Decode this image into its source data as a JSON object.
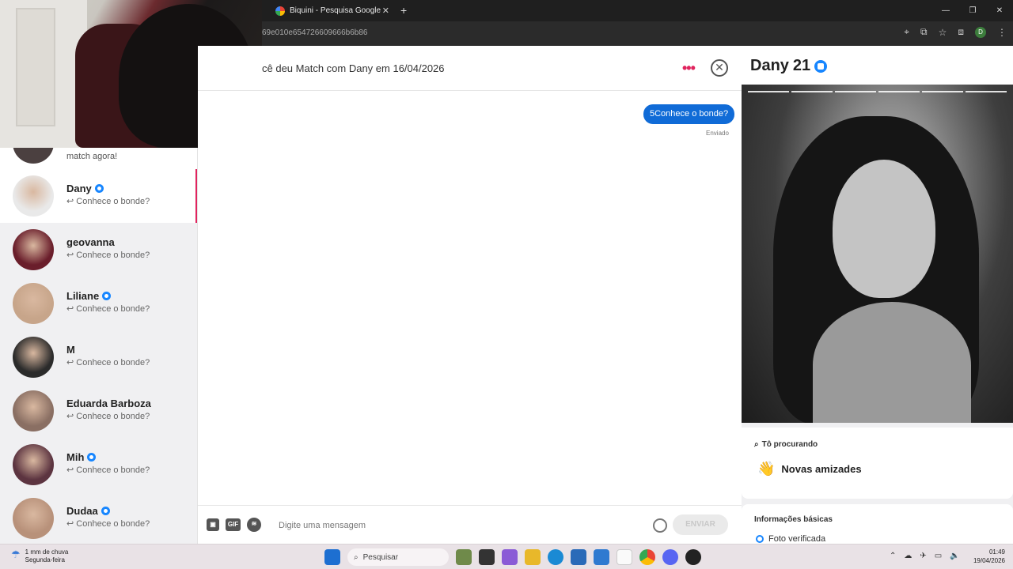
{
  "browser": {
    "tab_title": "Biquini - Pesquisa Google",
    "url_fragment": "69e010e654726609666b6b86",
    "close_tab": "✕",
    "new_tab": "+",
    "window_controls": [
      "—",
      "❐",
      "✕"
    ],
    "profile_initial": "D"
  },
  "sidebar": {
    "top_row_text": "match agora!",
    "items": [
      {
        "name": "Dany",
        "verified": true,
        "message": "↩ Conhece o bonde?",
        "active": true,
        "avatar_color": "#e9e9e9"
      },
      {
        "name": "geovanna",
        "verified": false,
        "message": "↩ Conhece o bonde?",
        "active": false,
        "avatar_color": "#6a1e2b"
      },
      {
        "name": "Liliane",
        "verified": true,
        "message": "↩ Conhece o bonde?",
        "active": false,
        "avatar_color": "#c7a58a"
      },
      {
        "name": "M",
        "verified": false,
        "message": "↩ Conhece o bonde?",
        "active": false,
        "avatar_color": "#2b2b2b"
      },
      {
        "name": "Eduarda Barboza",
        "verified": false,
        "message": "↩ Conhece o bonde?",
        "active": false,
        "avatar_color": "#8a6f63"
      },
      {
        "name": "Mih",
        "verified": true,
        "message": "↩ Conhece o bonde?",
        "active": false,
        "avatar_color": "#5c3440"
      },
      {
        "name": "Dudaa",
        "verified": true,
        "message": "↩ Conhece o bonde?",
        "active": false,
        "avatar_color": "#b8917a"
      }
    ]
  },
  "chat": {
    "title": "cê deu Match com Dany em 16/04/2026",
    "more": "•••",
    "close": "✕",
    "message": "5Conhece o bonde?",
    "status": "Enviado",
    "composer": {
      "placeholder": "Digite uma mensagem",
      "gif": "GIF",
      "send": "ENVIAR"
    }
  },
  "profile": {
    "name": "Dany",
    "age": "21",
    "looking_label": "Tô procurando",
    "looking_value": "Novas amizades",
    "basic_info_label": "Informações básicas",
    "verified_text": "Foto verificada"
  },
  "taskbar": {
    "weather_line1": "1 mm de chuva",
    "weather_line2": "Segunda-feira",
    "search_label": "Pesquisar",
    "time": "01:49",
    "date": "19/04/2026"
  }
}
